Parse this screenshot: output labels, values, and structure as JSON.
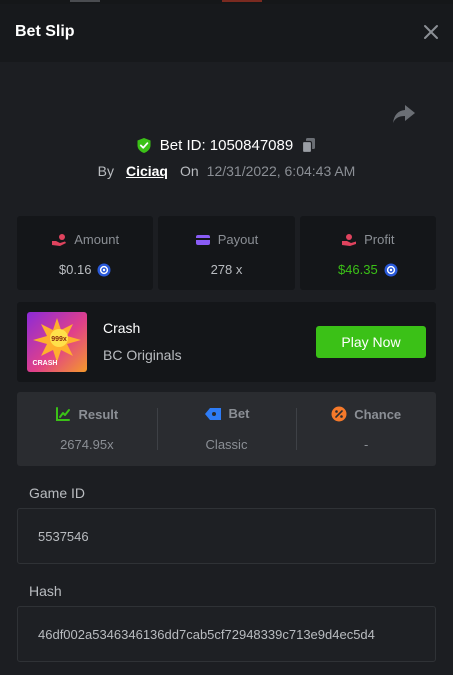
{
  "header": {
    "title": "Bet Slip"
  },
  "bet": {
    "id_text": "Bet ID: 1050847089",
    "by_label": "By",
    "user": "Ciciaq",
    "on_label": "On",
    "date": "12/31/2022, 6:04:43 AM"
  },
  "stats": {
    "amount_label": "Amount",
    "amount_value": "$0.16",
    "payout_label": "Payout",
    "payout_value": "278 x",
    "profit_label": "Profit",
    "profit_value": "$46.35"
  },
  "game": {
    "name": "Crash",
    "provider": "BC Originals",
    "thumb_text": "CRASH",
    "thumb_badge": "999x",
    "play_label": "Play Now"
  },
  "info": {
    "result_label": "Result",
    "result_value": "2674.95x",
    "bet_label": "Bet",
    "bet_value": "Classic",
    "chance_label": "Chance",
    "chance_value": "-"
  },
  "fields": {
    "game_id_label": "Game ID",
    "game_id_value": "5537546",
    "hash_label": "Hash",
    "hash_value": "46df002a5346346136dd7cab5cf72948339c713e9d4ec5d4"
  },
  "colors": {
    "accent_green": "#3bc117",
    "amount_icon": "#e0435e",
    "payout_icon": "#8a5cf6",
    "profit_icon": "#e0435e",
    "result_icon": "#3bc117",
    "bet_icon": "#2e7cf6",
    "chance_icon": "#f5792a"
  },
  "icons": {
    "close": "close-icon",
    "share": "share-icon",
    "verified": "shield-check-icon",
    "copy": "copy-icon",
    "amount": "hand-coins-icon",
    "payout": "wallet-icon",
    "profit": "profit-hand-icon",
    "coin": "coin-icon",
    "result": "result-chart-icon",
    "bet": "ticket-icon",
    "chance": "percent-icon"
  }
}
